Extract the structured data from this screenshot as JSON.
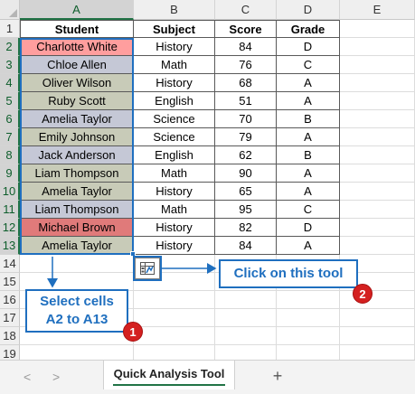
{
  "columns": [
    "A",
    "B",
    "C",
    "D",
    "E"
  ],
  "rows": [
    "1",
    "2",
    "3",
    "4",
    "5",
    "6",
    "7",
    "8",
    "9",
    "10",
    "11",
    "12",
    "13",
    "14",
    "15",
    "16",
    "17",
    "18",
    "19"
  ],
  "headers": {
    "student": "Student",
    "subject": "Subject",
    "score": "Score",
    "grade": "Grade"
  },
  "table": [
    {
      "student": "Charlotte White",
      "subject": "History",
      "score": "84",
      "grade": "D",
      "fill": "#ff9e9e"
    },
    {
      "student": "Chloe Allen",
      "subject": "Math",
      "score": "76",
      "grade": "C",
      "fill": "#c5c8d6"
    },
    {
      "student": "Oliver Wilson",
      "subject": "History",
      "score": "68",
      "grade": "A",
      "fill": "#c8cbb8"
    },
    {
      "student": "Ruby Scott",
      "subject": "English",
      "score": "51",
      "grade": "A",
      "fill": "#c8cbb8"
    },
    {
      "student": "Amelia Taylor",
      "subject": "Science",
      "score": "70",
      "grade": "B",
      "fill": "#c5c8d6"
    },
    {
      "student": "Emily Johnson",
      "subject": "Science",
      "score": "79",
      "grade": "A",
      "fill": "#c8cbb8"
    },
    {
      "student": "Jack Anderson",
      "subject": "English",
      "score": "62",
      "grade": "B",
      "fill": "#c5c8d6"
    },
    {
      "student": "Liam Thompson",
      "subject": "Math",
      "score": "90",
      "grade": "A",
      "fill": "#c8cbb8"
    },
    {
      "student": "Amelia Taylor",
      "subject": "History",
      "score": "65",
      "grade": "A",
      "fill": "#c8cbb8"
    },
    {
      "student": "Liam Thompson",
      "subject": "Math",
      "score": "95",
      "grade": "C",
      "fill": "#c5c8d6"
    },
    {
      "student": "Michael Brown",
      "subject": "History",
      "score": "82",
      "grade": "D",
      "fill": "#e07a7a"
    },
    {
      "student": "Amelia Taylor",
      "subject": "History",
      "score": "84",
      "grade": "A",
      "fill": "#c8cbb8"
    }
  ],
  "callouts": {
    "tool": "Click on this tool",
    "select_line1": "Select cells",
    "select_line2": "A2 to A13",
    "badge1": "1",
    "badge2": "2"
  },
  "icons": {
    "quick_analysis": "quick-analysis-icon",
    "prev": "chevron-left-icon",
    "next": "chevron-right-icon",
    "add": "plus-icon"
  },
  "colors": {
    "accent": "#1f6fbf",
    "excel_green": "#217346",
    "badge_red": "#d42020"
  },
  "sheet_tabs": {
    "active": "Quick Analysis Tool",
    "prev_arrow": "<",
    "next_arrow": ">",
    "add_sheet": "+"
  }
}
